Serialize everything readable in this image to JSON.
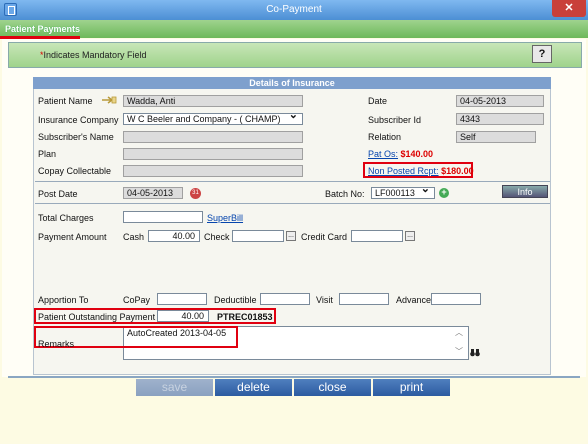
{
  "window": {
    "title": "Co-Payment",
    "close_glyph": "✕"
  },
  "tab": {
    "label": "Patient Payments"
  },
  "infobar": {
    "mandatory_star": "*",
    "mandatory_text": "Indicates Mandatory Field",
    "help_label": "?"
  },
  "section": {
    "title": "Details of Insurance"
  },
  "insurance": {
    "patient_name_label": "Patient Name",
    "patient_name": "Wadda, Anti",
    "date_label": "Date",
    "date": "04-05-2013",
    "insurance_company_label": "Insurance Company",
    "insurance_company": "W C Beeler and Company - ( CHAMP)",
    "subscriber_id_label": "Subscriber Id",
    "subscriber_id": "4343",
    "subscriber_name_label": "Subscriber's Name",
    "subscriber_name": "",
    "relation_label": "Relation",
    "relation": "Self",
    "plan_label": "Plan",
    "plan": "",
    "pat_os_prefix": "Pat Os:",
    "pat_os_amount": "$140.00",
    "copay_label": "Copay Collectable",
    "copay": "",
    "non_posted_prefix": "Non Posted Rcpt:",
    "non_posted_amount": "$180.00"
  },
  "posting": {
    "post_date_label": "Post Date",
    "post_date": "04-05-2013",
    "batch_label": "Batch No:",
    "batch": "LF000113",
    "info_label": "Info"
  },
  "payment": {
    "total_charges_label": "Total Charges",
    "total_charges": "",
    "superbill_label": "SuperBill",
    "payment_amount_label": "Payment Amount",
    "cash_label": "Cash",
    "cash": "40.00",
    "check_label": "Check",
    "check": "",
    "credit_card_label": "Credit Card",
    "credit_card": "",
    "ellipsis": "..."
  },
  "apportion": {
    "label": "Apportion To",
    "copay_label": "CoPay",
    "copay": "",
    "deductible_label": "Deductible",
    "deductible": "",
    "visit_label": "Visit",
    "visit": "",
    "advance_label": "Advance",
    "advance": ""
  },
  "outstanding": {
    "label": "Patient Outstanding Payment",
    "amount": "40.00",
    "receipt": "PTREC01853"
  },
  "remarks": {
    "label": "Remarks",
    "text": "AutoCreated 2013-04-05"
  },
  "footer": {
    "save": "save",
    "delete": "delete",
    "close": "close",
    "print": "print"
  },
  "colors": {
    "accent": "#2c5ba0",
    "highlight": "#e00010",
    "tab": "#6db85a"
  }
}
